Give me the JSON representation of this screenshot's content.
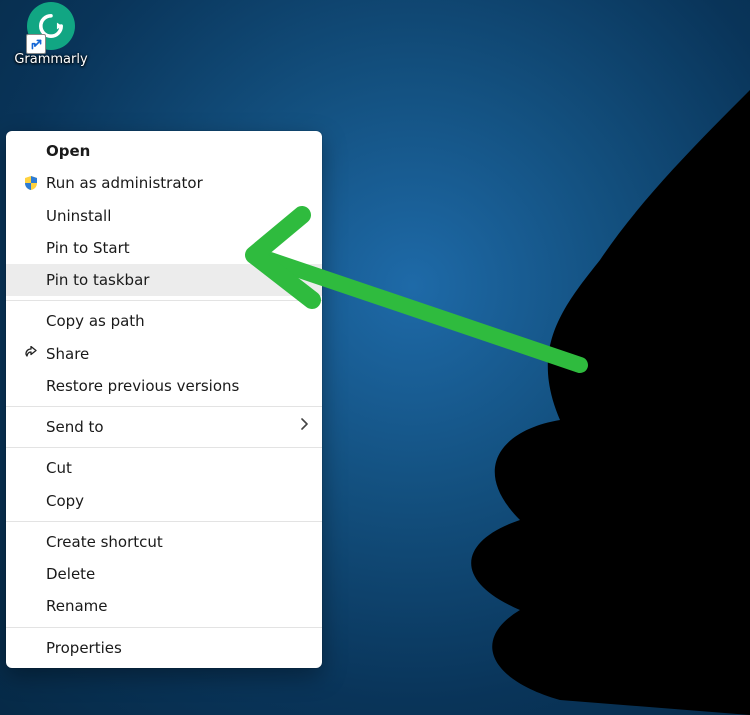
{
  "desktop_icon": {
    "label": "Grammarly"
  },
  "menu": {
    "open": "Open",
    "run_as_admin": "Run as administrator",
    "uninstall": "Uninstall",
    "pin_to_start": "Pin to Start",
    "pin_to_taskbar": "Pin to taskbar",
    "copy_as_path": "Copy as path",
    "share": "Share",
    "restore_prev": "Restore previous versions",
    "send_to": "Send to",
    "cut": "Cut",
    "copy": "Copy",
    "create_shortcut": "Create shortcut",
    "delete": "Delete",
    "rename": "Rename",
    "properties": "Properties"
  },
  "highlighted_item": "pin_to_taskbar",
  "annotation": {
    "arrow_color": "#2fbb3e"
  }
}
